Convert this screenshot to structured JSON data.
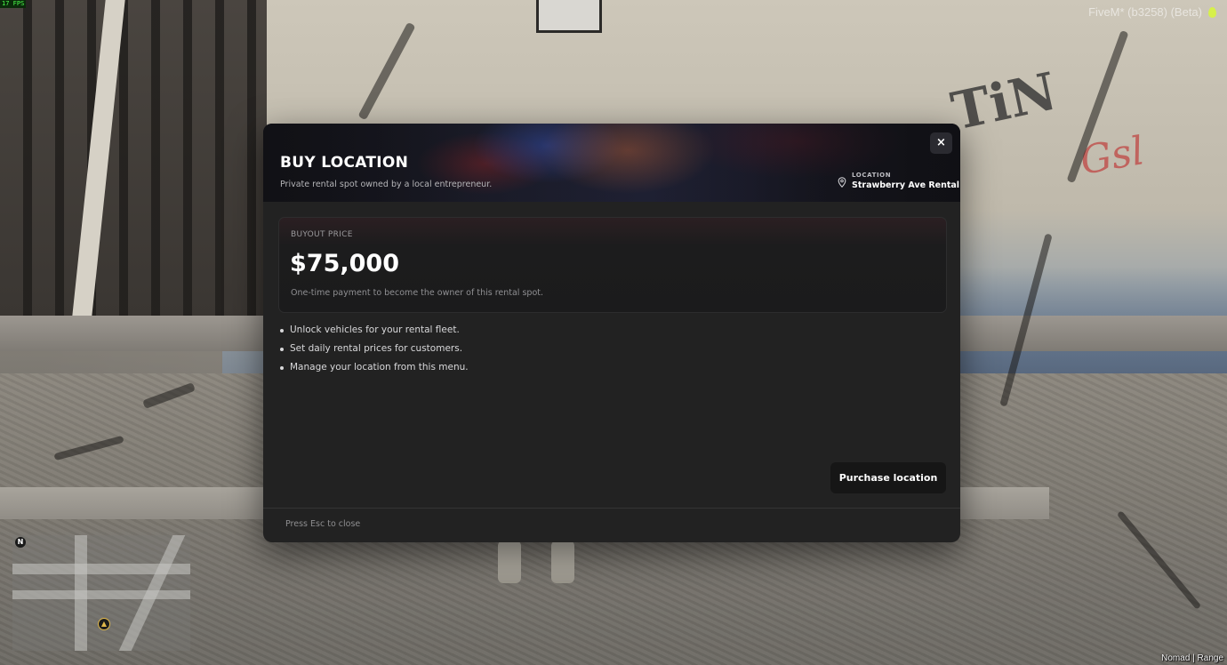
{
  "hud": {
    "fps": "17 FPS",
    "client_label": "FiveM* (b3258) (Beta)",
    "compass_letter": "N",
    "street_label": "Nomad | Range"
  },
  "modal": {
    "title": "BUY LOCATION",
    "subtitle": "Private rental spot owned by a local entrepreneur.",
    "close_icon": "×",
    "location": {
      "label": "LOCATION",
      "value": "Strawberry Ave Rental",
      "icon": "map-pin-icon"
    },
    "price": {
      "label": "BUYOUT PRICE",
      "value": "$75,000",
      "note": "One-time payment to become the owner of this rental spot."
    },
    "perks": [
      "Unlock vehicles for your rental fleet.",
      "Set daily rental prices for customers.",
      "Manage your location from this menu."
    ],
    "purchase_label": "Purchase location",
    "footer_hint": "Press Esc to close"
  },
  "colors": {
    "modal_bg": "#222222",
    "button_bg": "#161616",
    "text_primary": "#ffffff",
    "text_muted": "#8e8e90"
  }
}
